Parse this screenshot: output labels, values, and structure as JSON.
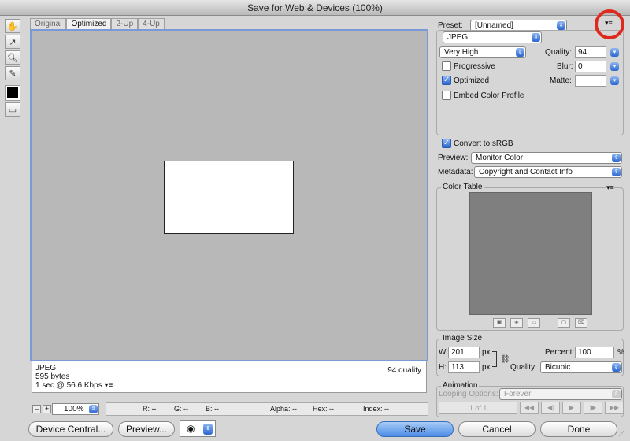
{
  "window": {
    "title": "Save for Web & Devices (100%)"
  },
  "tabs": [
    "Original",
    "Optimized",
    "2-Up",
    "4-Up"
  ],
  "tools": [
    "hand-icon",
    "slice-select-icon",
    "zoom-icon",
    "eyedropper-icon"
  ],
  "info": {
    "format": "JPEG",
    "size": "595 bytes",
    "time": "1 sec @ 56.6 Kbps",
    "quality": "94 quality",
    "menu": "▾≡"
  },
  "statusbar": {
    "zoom": "100%",
    "r": "R: --",
    "g": "G: --",
    "b": "B: --",
    "alpha": "Alpha: --",
    "hex": "Hex: --",
    "index": "Index: --"
  },
  "buttons": {
    "device_central": "Device Central...",
    "preview": "Preview...",
    "save": "Save",
    "cancel": "Cancel",
    "done": "Done"
  },
  "settings": {
    "preset_label": "Preset:",
    "preset_value": "[Unnamed]",
    "format": "JPEG",
    "quality_level": "Very High",
    "quality_label": "Quality:",
    "quality_value": "94",
    "blur_label": "Blur:",
    "blur_value": "0",
    "matte_label": "Matte:",
    "progressive": "Progressive",
    "optimized": "Optimized",
    "embed_profile": "Embed Color Profile",
    "convert_srgb": "Convert to sRGB",
    "preview_label": "Preview:",
    "preview_value": "Monitor Color",
    "metadata_label": "Metadata:",
    "metadata_value": "Copyright and Contact Info"
  },
  "color_table": {
    "title": "Color Table"
  },
  "image_size": {
    "title": "Image Size",
    "w_label": "W:",
    "w_value": "201",
    "h_label": "H:",
    "h_value": "113",
    "unit": "px",
    "percent_label": "Percent:",
    "percent_value": "100",
    "percent_unit": "%",
    "quality_label": "Quality:",
    "quality_value": "Bicubic"
  },
  "animation": {
    "title": "Animation",
    "looping_label": "Looping Options:",
    "looping_value": "Forever",
    "frame": "1 of 1"
  },
  "colors": {
    "accent": "#2a66cf",
    "highlight": "#e0291e"
  }
}
